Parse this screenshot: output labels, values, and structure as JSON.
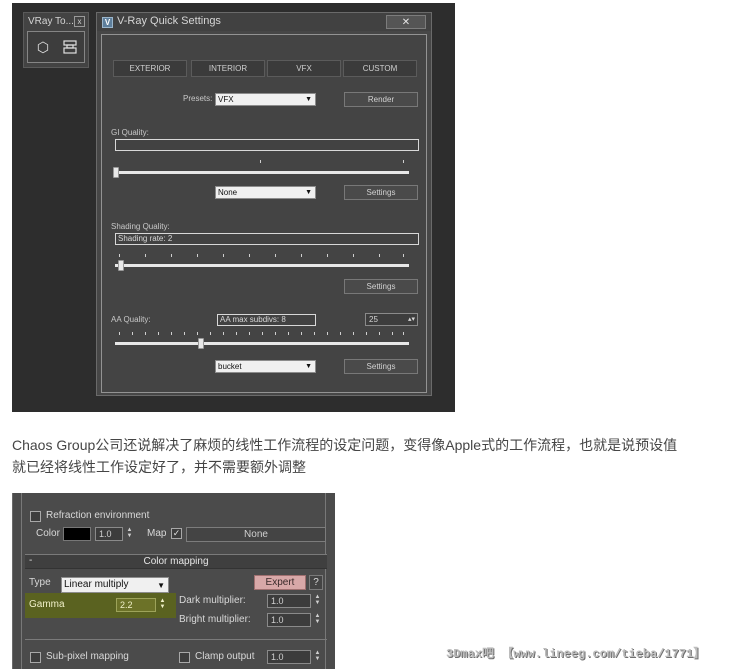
{
  "top_screenshot": {
    "toolbar": {
      "title": "VRay To...",
      "close": "x",
      "icons": [
        "hexagon-icon",
        "render-settings-icon"
      ]
    },
    "window": {
      "title": "V-Ray Quick Settings",
      "close": "✕",
      "tabs": [
        "EXTERIOR",
        "INTERIOR",
        "VFX",
        "CUSTOM"
      ],
      "presets": {
        "label": "Presets:",
        "value": "VFX",
        "render_button": "Render"
      },
      "gi": {
        "label": "GI Quality:",
        "slider_level": 0.0,
        "mode": "None",
        "settings_button": "Settings"
      },
      "shading": {
        "label": "Shading Quality:",
        "readout": "Shading rate: 2",
        "slider_level": 0.02,
        "settings_button": "Settings"
      },
      "aa": {
        "label": "AA Quality:",
        "readout": "AA max subdivs: 8",
        "spinner": "25",
        "slider_level": 0.3,
        "mode": "bucket",
        "settings_button": "Settings"
      }
    }
  },
  "paragraph": {
    "line1": "Chaos Group公司还说解决了麻烦的线性工作流程的设定问题，变得像Apple式的工作流程，也就是说预设值",
    "line2": "就已经将线性工作设定好了，并不需要额外调整"
  },
  "bottom_screenshot": {
    "refraction": {
      "label": "Refraction environment",
      "color_label": "Color",
      "color_swatch": "#000000",
      "multiplier": "1.0",
      "map_label": "Map",
      "map_button": "None"
    },
    "color_mapping": {
      "title": "Color mapping",
      "collapse": "-",
      "type_label": "Type",
      "type_value": "Linear multiply",
      "expert_button": "Expert",
      "help_button": "?",
      "gamma_label": "Gamma",
      "gamma_value": "2.2",
      "dark_label": "Dark multiplier:",
      "dark_value": "1.0",
      "bright_label": "Bright multiplier:",
      "bright_value": "1.0"
    },
    "subpixel": {
      "label": "Sub-pixel mapping"
    },
    "clamp": {
      "label": "Clamp output",
      "value": "1.0"
    }
  },
  "watermark": "3Dmax吧 【www.lineeg.com/tieba/1771】",
  "colors": {
    "dark_panel": "#474747",
    "expert_button": "#d8a8a8",
    "gamma_highlight": "#5a6220"
  }
}
